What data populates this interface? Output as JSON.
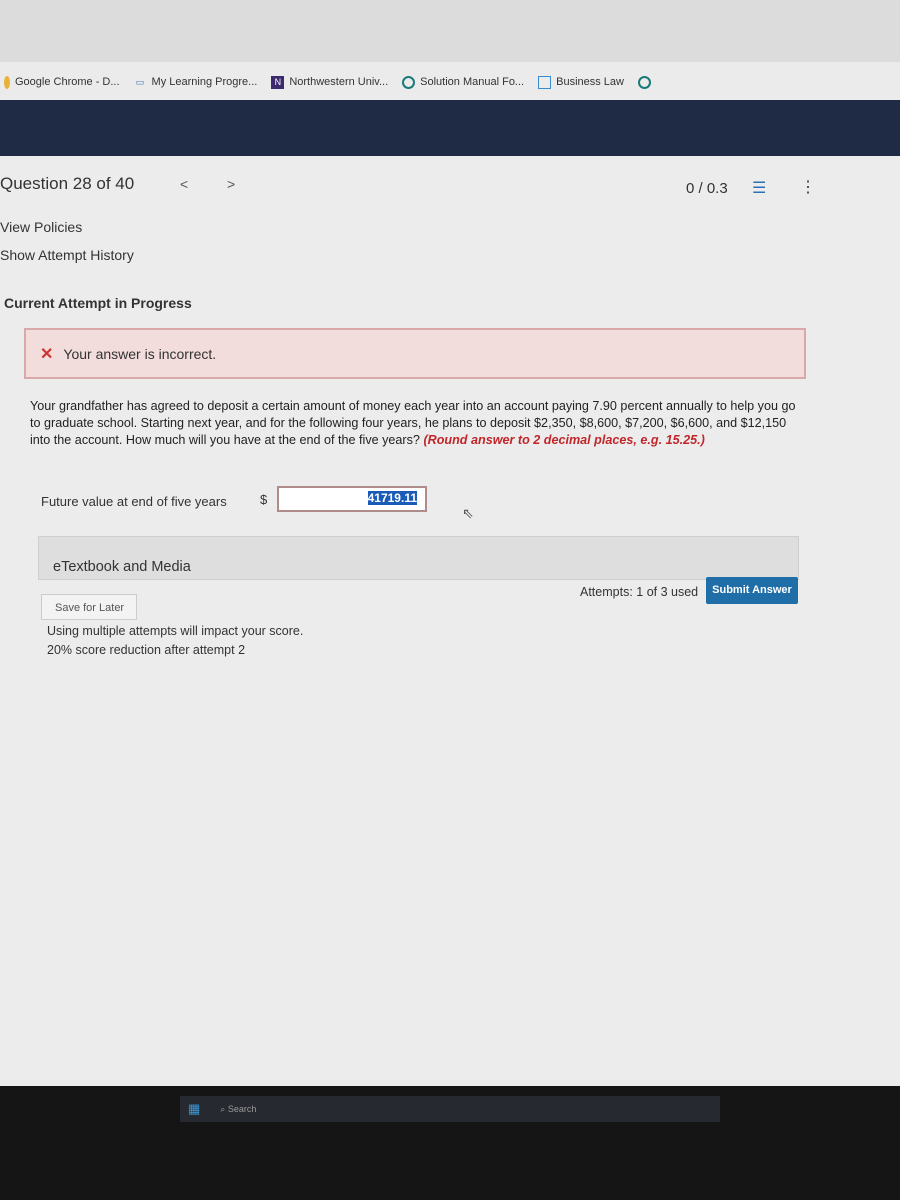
{
  "bookmarks": [
    "Google Chrome - D...",
    "My Learning Progre...",
    "Northwestern Univ...",
    "Solution Manual Fo...",
    "Business Law"
  ],
  "question": {
    "title": "Question 28 of 40",
    "prev": "<",
    "next": ">",
    "score": "0 / 0.3"
  },
  "links": {
    "policies": "View Policies",
    "history": "Show Attempt History"
  },
  "attempt_heading": "Current Attempt in Progress",
  "feedback": "Your answer is incorrect.",
  "question_text": "Your grandfather has agreed to deposit a certain amount of money each year into an account paying 7.90 percent annually to help you go to graduate school. Starting next year, and for the following four years, he plans to deposit $2,350, $8,600, $7,200, $6,600, and $12,150 into the account. How much will you have at the end of the five years?",
  "instruction": "(Round answer to 2 decimal places, e.g. 15.25.)",
  "answer": {
    "label": "Future value at end of five years",
    "currency": "$",
    "value": "41719.11"
  },
  "etextbook": "eTextbook and Media",
  "save_label": "Save for Later",
  "warning1": "Using multiple attempts will impact your score.",
  "warning2": "20% score reduction after attempt 2",
  "attempts": "Attempts: 1 of 3 used",
  "submit_label": "Submit Answer",
  "taskbar_search": "Search",
  "colors": {
    "submit": "#1f6ea8",
    "error_bg": "#f2dcdc",
    "instruction": "#c0262a"
  }
}
